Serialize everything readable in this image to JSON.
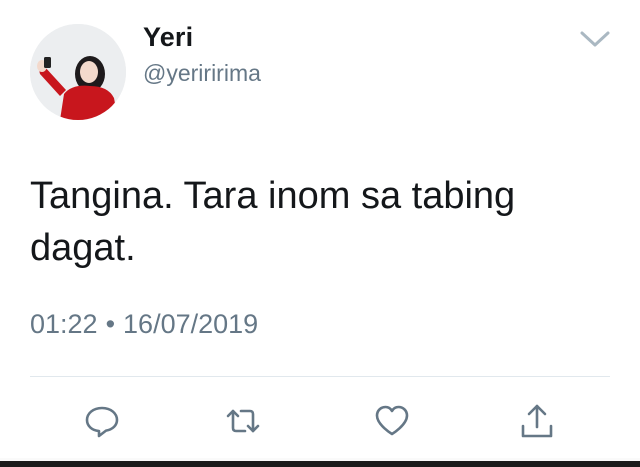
{
  "tweet": {
    "display_name": "Yeri",
    "handle": "@yeriririma",
    "text_line1": "Tangina. Tara inom sa tabing",
    "text_line2": "dagat.",
    "time": "01:22",
    "separator": "•",
    "date": "16/07/2019"
  },
  "icons": {
    "menu": "chevron-down-icon",
    "reply": "reply-icon",
    "retweet": "retweet-icon",
    "like": "heart-icon",
    "share": "share-icon"
  },
  "colors": {
    "text": "#14171a",
    "secondary": "#657786",
    "icon": "#657786",
    "divider": "#e1e8ed"
  }
}
